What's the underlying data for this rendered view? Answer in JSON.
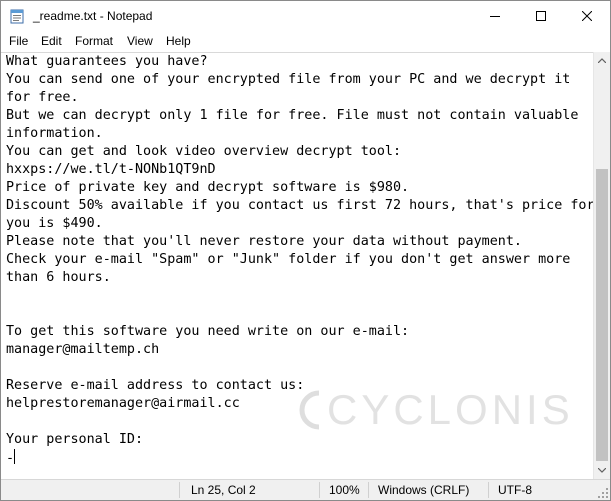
{
  "window": {
    "title": "_readme.txt - Notepad",
    "icon": "notepad-icon"
  },
  "menu": [
    "File",
    "Edit",
    "Format",
    "View",
    "Help"
  ],
  "document": {
    "lines": [
      "What guarantees you have?",
      "You can send one of your encrypted file from your PC and we decrypt it",
      "for free.",
      "But we can decrypt only 1 file for free. File must not contain valuable",
      "information.",
      "You can get and look video overview decrypt tool:",
      "hxxps://we.tl/t-NONb1QT9nD",
      "Price of private key and decrypt software is $980.",
      "Discount 50% available if you contact us first 72 hours, that's price for",
      "you is $490.",
      "Please note that you'll never restore your data without payment.",
      "Check your e-mail \"Spam\" or \"Junk\" folder if you don't get answer more",
      "than 6 hours.",
      "",
      "",
      "To get this software you need write on our e-mail:",
      "manager@mailtemp.ch",
      "",
      "Reserve e-mail address to contact us:",
      "helprestoremanager@airmail.cc",
      "",
      "Your personal ID:",
      "-"
    ]
  },
  "watermark": {
    "text": "CYCLONIS",
    "icon": "cyclonis-logo-icon"
  },
  "status": {
    "position": "Ln 25, Col 2",
    "zoom": "100%",
    "line_ending": "Windows (CRLF)",
    "encoding": "UTF-8"
  }
}
